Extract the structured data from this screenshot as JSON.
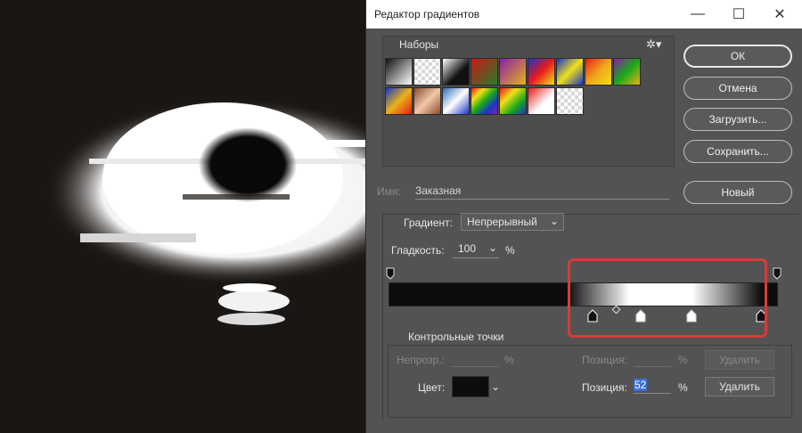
{
  "dialog": {
    "title": "Редактор градиентов",
    "presets_label": "Наборы",
    "buttons": {
      "ok": "ОК",
      "cancel": "Отмена",
      "load": "Загрузить...",
      "save": "Сохранить...",
      "new": "Новый"
    },
    "name_label": "Имя:",
    "name_value": "Заказная",
    "gradient_type_label": "Градиент:",
    "gradient_type_value": "Непрерывный",
    "smoothness_label": "Гладкость:",
    "smoothness_value": "100",
    "smoothness_unit": "%",
    "stops_section_label": "Контрольные точки",
    "opacity_label": "Непрозр.:",
    "opacity_unit": "%",
    "opacity_position_label": "Позиция:",
    "opacity_position_unit": "%",
    "opacity_delete": "Удалить",
    "color_label": "Цвет:",
    "color_position_label": "Позиция:",
    "color_position_value": "52",
    "color_position_unit": "%",
    "color_delete": "Удалить",
    "gear_icon": "gear-icon",
    "colors": {
      "highlight": "#d93a3a",
      "selection": "#3b6fd8",
      "stop_color": "#0f0d0c"
    }
  },
  "window_controls": {
    "minimize": "—",
    "maximize": "☐",
    "close": "✕"
  }
}
